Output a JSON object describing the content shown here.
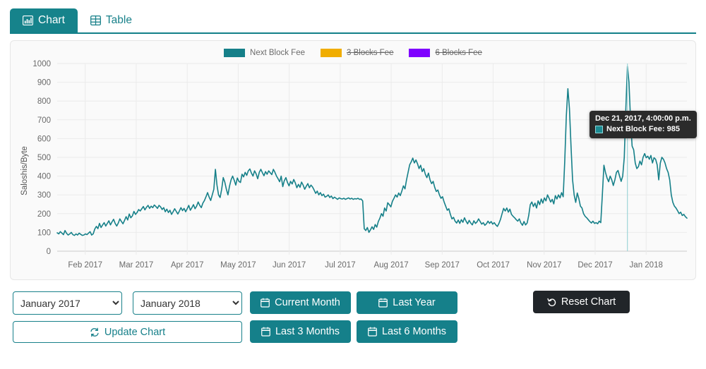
{
  "theme": {
    "accent": "#15808a",
    "accent_dark": "#0f6d75",
    "series_next_block": "#168089",
    "series_3_blocks": "#f0ad00",
    "series_6_blocks": "#7f00ff",
    "panel_bg": "#fafafa",
    "tooltip_bg": "#2b2b2b",
    "reset_bg": "#212529"
  },
  "tabs": [
    {
      "id": "chart",
      "label": "Chart",
      "icon": "bar-chart-icon",
      "active": true
    },
    {
      "id": "table",
      "label": "Table",
      "icon": "table-icon",
      "active": false
    }
  ],
  "legend": [
    {
      "label": "Next Block Fee",
      "color": "#168089",
      "enabled": true
    },
    {
      "label": "3 Blocks Fee",
      "color": "#f0ad00",
      "enabled": false
    },
    {
      "label": "6 Blocks Fee",
      "color": "#7f00ff",
      "enabled": false
    }
  ],
  "tooltip": {
    "title": "Dec 21, 2017, 4:00:00 p.m.",
    "series_label": "Next Block Fee",
    "value": "985",
    "row_text": "Next Block Fee: 985",
    "swatch_color": "#168089"
  },
  "controls": {
    "start_month": {
      "name": "start-month-select",
      "value": "January 2017",
      "options": [
        "January 2017",
        "January 2018"
      ]
    },
    "end_month": {
      "name": "end-month-select",
      "value": "January 2018",
      "options": [
        "January 2017",
        "January 2018"
      ]
    },
    "update_chart": {
      "label": "Update Chart",
      "icon": "refresh-icon"
    },
    "current_month": {
      "label": "Current Month",
      "icon": "calendar-icon"
    },
    "last_year": {
      "label": "Last Year",
      "icon": "calendar-icon"
    },
    "last_3_months": {
      "label": "Last 3 Months",
      "icon": "calendar-icon"
    },
    "last_6_months": {
      "label": "Last 6 Months",
      "icon": "calendar-icon"
    },
    "reset_chart": {
      "label": "Reset Chart",
      "icon": "undo-icon"
    }
  },
  "chart_data": {
    "type": "line",
    "title": "",
    "xlabel": "",
    "ylabel": "Saloshis/Byte",
    "ylim": [
      0,
      1000
    ],
    "yticks": [
      0,
      100,
      200,
      300,
      400,
      500,
      600,
      700,
      800,
      900,
      1000
    ],
    "xticks": [
      "Feb 2017",
      "Mar 2017",
      "Apr 2017",
      "May 2017",
      "Jun 2017",
      "Jul 2017",
      "Aug 2017",
      "Sep 2017",
      "Oct 2017",
      "Nov 2017",
      "Dec 2017",
      "Jan 2018"
    ],
    "x_range": [
      "Jan 2017",
      "Jan 2018"
    ],
    "grid": true,
    "legend_position": "top-center",
    "series": [
      {
        "name": "Next Block Fee",
        "color": "#168089",
        "visible": true,
        "values": [
          98,
          92,
          104,
          96,
          88,
          110,
          95,
          86,
          92,
          100,
          88,
          84,
          92,
          86,
          96,
          90,
          84,
          86,
          92,
          88,
          96,
          104,
          86,
          92,
          118,
          132,
          120,
          148,
          126,
          140,
          152,
          134,
          148,
          162,
          140,
          156,
          170,
          148,
          134,
          150,
          172,
          158,
          146,
          164,
          184,
          166,
          198,
          178,
          188,
          212,
          196,
          206,
          222,
          214,
          226,
          238,
          220,
          234,
          244,
          228,
          240,
          232,
          246,
          238,
          228,
          244,
          236,
          222,
          232,
          210,
          224,
          206,
          218,
          196,
          210,
          226,
          212,
          198,
          214,
          232,
          216,
          228,
          210,
          226,
          244,
          218,
          232,
          248,
          226,
          240,
          262,
          244,
          232,
          256,
          270,
          290,
          312,
          288,
          270,
          300,
          330,
          436,
          352,
          300,
          286,
          330,
          392,
          368,
          330,
          300,
          346,
          380,
          400,
          378,
          352,
          390,
          372,
          366,
          410,
          396,
          420,
          404,
          428,
          438,
          416,
          400,
          428,
          412,
          386,
          420,
          436,
          418,
          402,
          424,
          410,
          428,
          418,
          408,
          436,
          420,
          400,
          386,
          370,
          400,
          344,
          376,
          392,
          366,
          348,
          372,
          358,
          382,
          364,
          338,
          356,
          340,
          368,
          352,
          330,
          346,
          360,
          338,
          352,
          342,
          326,
          308,
          320,
          300,
          312,
          296,
          304,
          288,
          292,
          300,
          286,
          294,
          280,
          288,
          282,
          276,
          284,
          280,
          278,
          282,
          276,
          280,
          284,
          278,
          282,
          276,
          280,
          278,
          282,
          276,
          278,
          268,
          120,
          110,
          126,
          100,
          114,
          130,
          116,
          142,
          128,
          158,
          176,
          200,
          186,
          230,
          214,
          258,
          248,
          236,
          266,
          282,
          300,
          288,
          310,
          296,
          320,
          348,
          332,
          380,
          420,
          460,
          476,
          496,
          470,
          486,
          466,
          440,
          458,
          424,
          440,
          410,
          392,
          416,
          380,
          360,
          372,
          340,
          318,
          326,
          300,
          282,
          290,
          262,
          240,
          218,
          226,
          196,
          172,
          180,
          160,
          150,
          166,
          148,
          168,
          154,
          178,
          160,
          146,
          164,
          150,
          140,
          162,
          148,
          156,
          172,
          158,
          144,
          152,
          138,
          146,
          160,
          148,
          158,
          144,
          152,
          140,
          132,
          148,
          170,
          200,
          228,
          214,
          230,
          208,
          224,
          196,
          186,
          178,
          168,
          160,
          172,
          150,
          138,
          158,
          140,
          150,
          190,
          248,
          262,
          238,
          256,
          230,
          268,
          248,
          278,
          256,
          284,
          268,
          300,
          282,
          262,
          276,
          252,
          296,
          278,
          300,
          284,
          312,
          290,
          480,
          720,
          866,
          760,
          560,
          380,
          300,
          260,
          310,
          280,
          240,
          230,
          200,
          186,
          178,
          168,
          158,
          150,
          160,
          148,
          152,
          146,
          160,
          152,
          300,
          458,
          420,
          390,
          370,
          400,
          380,
          350,
          380,
          420,
          430,
          400,
          372,
          400,
          500,
          760,
          985,
          900,
          700,
          560,
          540,
          470,
          440,
          450,
          480,
          460,
          500,
          520,
          498,
          506,
          490,
          510,
          470,
          498,
          490,
          460,
          380,
          470,
          500,
          490,
          470,
          440,
          420,
          380,
          300,
          260,
          240,
          230,
          216,
          200,
          208,
          190,
          196,
          184,
          176
        ]
      },
      {
        "name": "3 Blocks Fee",
        "color": "#f0ad00",
        "visible": false,
        "values": []
      },
      {
        "name": "6 Blocks Fee",
        "color": "#7f00ff",
        "visible": false,
        "values": []
      }
    ],
    "annotations": [
      {
        "type": "tooltip",
        "x": "Dec 21, 2017, 4:00:00 p.m.",
        "series": "Next Block Fee",
        "y": 985
      }
    ]
  }
}
